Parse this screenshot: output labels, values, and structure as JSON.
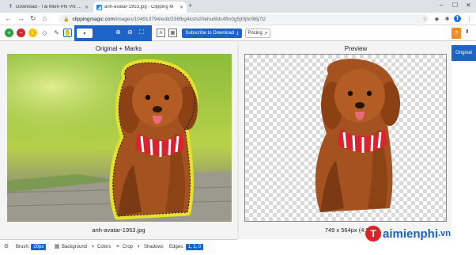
{
  "browser": {
    "tabs": [
      {
        "title": "Download - Tải Miễn Phí VN - Pl",
        "active": false
      },
      {
        "title": "anh-avatar-1953.jpg - Clipping M",
        "active": true
      }
    ],
    "url_host": "clippingmagic.com",
    "url_path": "/images/104913794/edit/336fbg4kshi20ehu8fdc4ftn0g5jt0jhr9l6j7l2"
  },
  "toolbar": {
    "brush_size_dropdown": "▾",
    "subscribe_label": "Subscribe to Download",
    "pricing_label": "Pricing",
    "info_label": "?"
  },
  "panels": {
    "left_title": "Original + Marks",
    "right_title": "Preview",
    "original_tab": "Original",
    "left_caption": "anh-avatar-1953.jpg",
    "right_caption": "749 x 564px (4:3)"
  },
  "bottom_bar": {
    "brush_label": "Brush:",
    "brush_value": "20px",
    "background_label": "Background",
    "colors_label": "Colors",
    "crop_label": "Crop",
    "shadows_label": "Shadows",
    "edges_label": "Edges:",
    "edges_value": "1, 1, 0"
  },
  "watermark": {
    "logo_letter": "T",
    "text": "aimienphi",
    "suffix": ".vn"
  },
  "colors": {
    "brand_blue": "#1e63c6",
    "keep_green": "#2e9e3e",
    "remove_red": "#d7262b",
    "highlight_yellow": "#f4c20d"
  }
}
